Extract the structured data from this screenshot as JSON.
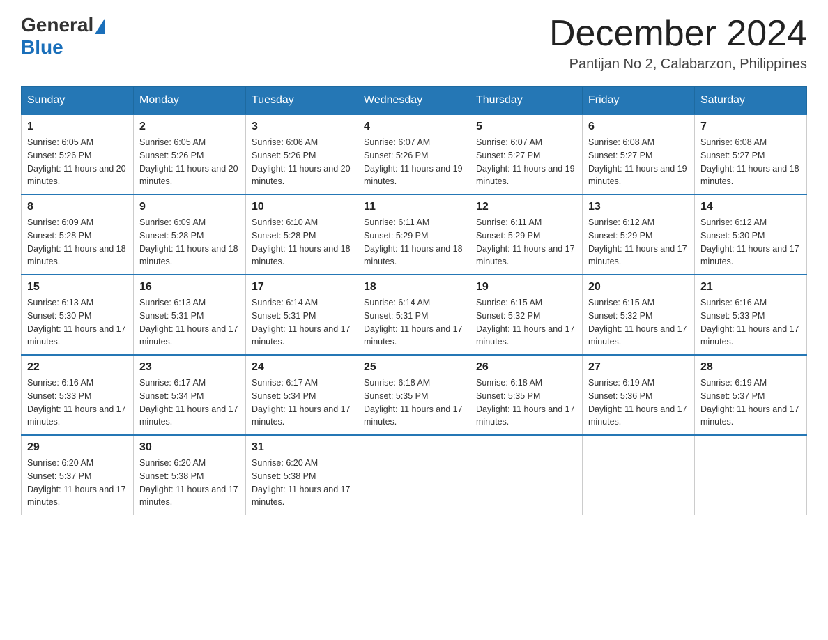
{
  "header": {
    "logo_general": "General",
    "logo_blue": "Blue",
    "month_year": "December 2024",
    "location": "Pantijan No 2, Calabarzon, Philippines"
  },
  "weekdays": [
    "Sunday",
    "Monday",
    "Tuesday",
    "Wednesday",
    "Thursday",
    "Friday",
    "Saturday"
  ],
  "weeks": [
    [
      {
        "day": "1",
        "sunrise": "6:05 AM",
        "sunset": "5:26 PM",
        "daylight": "11 hours and 20 minutes."
      },
      {
        "day": "2",
        "sunrise": "6:05 AM",
        "sunset": "5:26 PM",
        "daylight": "11 hours and 20 minutes."
      },
      {
        "day": "3",
        "sunrise": "6:06 AM",
        "sunset": "5:26 PM",
        "daylight": "11 hours and 20 minutes."
      },
      {
        "day": "4",
        "sunrise": "6:07 AM",
        "sunset": "5:26 PM",
        "daylight": "11 hours and 19 minutes."
      },
      {
        "day": "5",
        "sunrise": "6:07 AM",
        "sunset": "5:27 PM",
        "daylight": "11 hours and 19 minutes."
      },
      {
        "day": "6",
        "sunrise": "6:08 AM",
        "sunset": "5:27 PM",
        "daylight": "11 hours and 19 minutes."
      },
      {
        "day": "7",
        "sunrise": "6:08 AM",
        "sunset": "5:27 PM",
        "daylight": "11 hours and 18 minutes."
      }
    ],
    [
      {
        "day": "8",
        "sunrise": "6:09 AM",
        "sunset": "5:28 PM",
        "daylight": "11 hours and 18 minutes."
      },
      {
        "day": "9",
        "sunrise": "6:09 AM",
        "sunset": "5:28 PM",
        "daylight": "11 hours and 18 minutes."
      },
      {
        "day": "10",
        "sunrise": "6:10 AM",
        "sunset": "5:28 PM",
        "daylight": "11 hours and 18 minutes."
      },
      {
        "day": "11",
        "sunrise": "6:11 AM",
        "sunset": "5:29 PM",
        "daylight": "11 hours and 18 minutes."
      },
      {
        "day": "12",
        "sunrise": "6:11 AM",
        "sunset": "5:29 PM",
        "daylight": "11 hours and 17 minutes."
      },
      {
        "day": "13",
        "sunrise": "6:12 AM",
        "sunset": "5:29 PM",
        "daylight": "11 hours and 17 minutes."
      },
      {
        "day": "14",
        "sunrise": "6:12 AM",
        "sunset": "5:30 PM",
        "daylight": "11 hours and 17 minutes."
      }
    ],
    [
      {
        "day": "15",
        "sunrise": "6:13 AM",
        "sunset": "5:30 PM",
        "daylight": "11 hours and 17 minutes."
      },
      {
        "day": "16",
        "sunrise": "6:13 AM",
        "sunset": "5:31 PM",
        "daylight": "11 hours and 17 minutes."
      },
      {
        "day": "17",
        "sunrise": "6:14 AM",
        "sunset": "5:31 PM",
        "daylight": "11 hours and 17 minutes."
      },
      {
        "day": "18",
        "sunrise": "6:14 AM",
        "sunset": "5:31 PM",
        "daylight": "11 hours and 17 minutes."
      },
      {
        "day": "19",
        "sunrise": "6:15 AM",
        "sunset": "5:32 PM",
        "daylight": "11 hours and 17 minutes."
      },
      {
        "day": "20",
        "sunrise": "6:15 AM",
        "sunset": "5:32 PM",
        "daylight": "11 hours and 17 minutes."
      },
      {
        "day": "21",
        "sunrise": "6:16 AM",
        "sunset": "5:33 PM",
        "daylight": "11 hours and 17 minutes."
      }
    ],
    [
      {
        "day": "22",
        "sunrise": "6:16 AM",
        "sunset": "5:33 PM",
        "daylight": "11 hours and 17 minutes."
      },
      {
        "day": "23",
        "sunrise": "6:17 AM",
        "sunset": "5:34 PM",
        "daylight": "11 hours and 17 minutes."
      },
      {
        "day": "24",
        "sunrise": "6:17 AM",
        "sunset": "5:34 PM",
        "daylight": "11 hours and 17 minutes."
      },
      {
        "day": "25",
        "sunrise": "6:18 AM",
        "sunset": "5:35 PM",
        "daylight": "11 hours and 17 minutes."
      },
      {
        "day": "26",
        "sunrise": "6:18 AM",
        "sunset": "5:35 PM",
        "daylight": "11 hours and 17 minutes."
      },
      {
        "day": "27",
        "sunrise": "6:19 AM",
        "sunset": "5:36 PM",
        "daylight": "11 hours and 17 minutes."
      },
      {
        "day": "28",
        "sunrise": "6:19 AM",
        "sunset": "5:37 PM",
        "daylight": "11 hours and 17 minutes."
      }
    ],
    [
      {
        "day": "29",
        "sunrise": "6:20 AM",
        "sunset": "5:37 PM",
        "daylight": "11 hours and 17 minutes."
      },
      {
        "day": "30",
        "sunrise": "6:20 AM",
        "sunset": "5:38 PM",
        "daylight": "11 hours and 17 minutes."
      },
      {
        "day": "31",
        "sunrise": "6:20 AM",
        "sunset": "5:38 PM",
        "daylight": "11 hours and 17 minutes."
      },
      null,
      null,
      null,
      null
    ]
  ]
}
